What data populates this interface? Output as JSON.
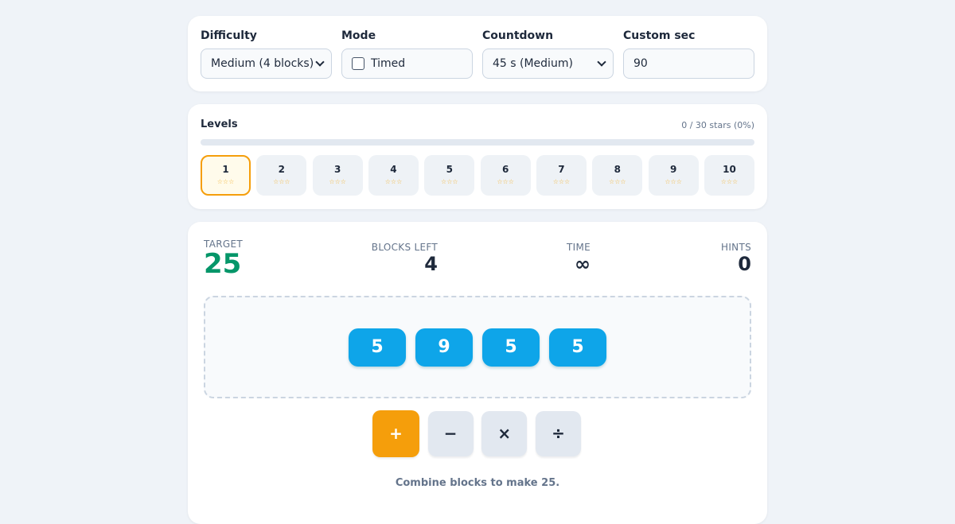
{
  "settings": {
    "difficulty": {
      "label": "Difficulty",
      "value": "Medium (4 blocks)"
    },
    "mode": {
      "label": "Mode",
      "checkbox_label": "Timed",
      "checked": false
    },
    "countdown": {
      "label": "Countdown",
      "value": "45 s (Medium)"
    },
    "custom": {
      "label": "Custom sec",
      "value": "90"
    }
  },
  "levels": {
    "title": "Levels",
    "stats": "0 / 30 stars (0%)",
    "progress_fraction": 0,
    "items": [
      {
        "number": "1",
        "stars": "☆☆☆",
        "active": true
      },
      {
        "number": "2",
        "stars": "☆☆☆",
        "active": false
      },
      {
        "number": "3",
        "stars": "☆☆☆",
        "active": false
      },
      {
        "number": "4",
        "stars": "☆☆☆",
        "active": false
      },
      {
        "number": "5",
        "stars": "☆☆☆",
        "active": false
      },
      {
        "number": "6",
        "stars": "☆☆☆",
        "active": false
      },
      {
        "number": "7",
        "stars": "☆☆☆",
        "active": false
      },
      {
        "number": "8",
        "stars": "☆☆☆",
        "active": false
      },
      {
        "number": "9",
        "stars": "☆☆☆",
        "active": false
      },
      {
        "number": "10",
        "stars": "☆☆☆",
        "active": false
      }
    ]
  },
  "game": {
    "target": {
      "label": "TARGET",
      "value": "25"
    },
    "blocks_left": {
      "label": "BLOCKS LEFT",
      "value": "4"
    },
    "time": {
      "label": "TIME",
      "value": "∞"
    },
    "hints": {
      "label": "HINTS",
      "value": "0"
    },
    "blocks": [
      "5",
      "9",
      "5",
      "5"
    ],
    "operators": [
      {
        "symbol": "+",
        "name": "add",
        "active": true
      },
      {
        "symbol": "−",
        "name": "subtract",
        "active": false
      },
      {
        "symbol": "×",
        "name": "multiply",
        "active": false
      },
      {
        "symbol": "÷",
        "name": "divide",
        "active": false
      }
    ],
    "message": "Combine blocks to make 25."
  },
  "colors": {
    "accent": "#f59e0b",
    "block": "#0ea5e9",
    "target": "#059669",
    "background": "#eff3f8"
  }
}
